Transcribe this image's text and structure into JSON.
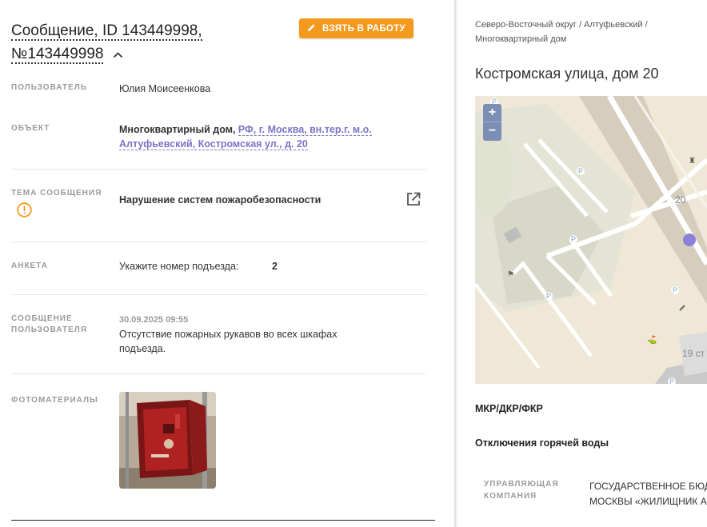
{
  "message": {
    "title_line1": "Сообщение, ID 143449998,",
    "title_line2": "№143449998",
    "take_button": "ВЗЯТЬ В РАБОТУ"
  },
  "fields": {
    "user_label": "ПОЛЬЗОВАТЕЛЬ",
    "user_value": "Юлия Моисеенкова",
    "object_label": "ОБЪЕКТ",
    "object_type": "Многоквартирный дом,",
    "object_address_1": "РФ, г. Москва, вн.тер.г. м.о.",
    "object_address_2": "Алтуфьевский, Костромская ул., д. 20",
    "topic_label": "ТЕМА СООБЩЕНИЯ",
    "topic_value": "Нарушение систем пожаробезопасности",
    "form_label": "АНКЕТА",
    "form_question": "Укажите номер подъезда:",
    "form_answer": "2",
    "user_message_label_1": "СООБЩЕНИЕ",
    "user_message_label_2": "ПОЛЬЗОВАТЕЛЯ",
    "user_message_date": "30.09.2025 09:55",
    "user_message_text_1": "Отсутствие пожарных рукавов во всех шкафах",
    "user_message_text_2": "подъезда.",
    "photos_label": "ФОТОМАТЕРИАЛЫ"
  },
  "right_panel": {
    "breadcrumb_line1": "Северо-Восточный округ / Алтуфьевский /",
    "breadcrumb_line2": "Многоквартирный дом",
    "address": "Костромская улица, дом 20",
    "map": {
      "zoom_in": "+",
      "zoom_out": "−",
      "building_20": "20",
      "building_19": "19 ст"
    },
    "mkr": "МКР/ДКР/ФКР",
    "hot_water": "Отключения горячей воды",
    "mgmt_label_1": "УПРАВЛЯЮЩАЯ",
    "mgmt_label_2": "КОМПАНИЯ",
    "mgmt_value_1": "ГОСУДАРСТВЕННОЕ БЮД",
    "mgmt_value_2": "МОСКВЫ «ЖИЛИЩНИК А"
  },
  "colors": {
    "accent_orange": "#f39a1e",
    "link_purple": "#7b74c8",
    "label_gray": "#9a9a9a",
    "map_pin": "#8b80d8"
  },
  "icons": [
    "pencil-icon",
    "chevron-up-icon",
    "warning-circle-icon",
    "external-link-icon",
    "map-pin-icon"
  ]
}
